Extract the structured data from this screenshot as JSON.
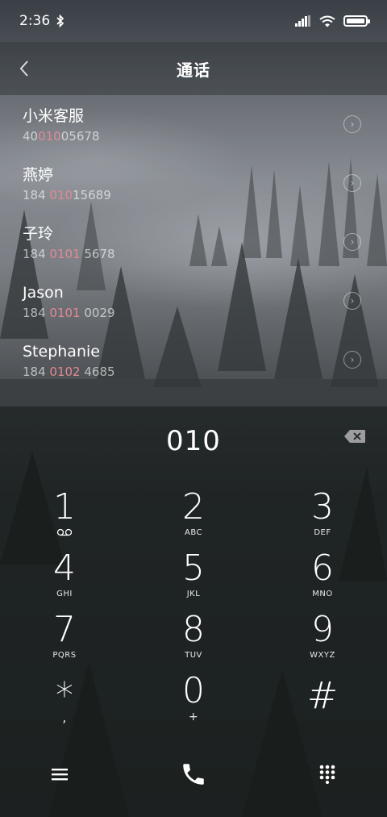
{
  "status_bar": {
    "time": "2:36",
    "icons": [
      "bluetooth-icon",
      "signal-icon",
      "wifi-icon",
      "battery-icon"
    ]
  },
  "header": {
    "title": "通话",
    "back_icon": "chevron-left-icon"
  },
  "results": [
    {
      "name": "小米客服",
      "number_pre": "40",
      "number_match": "010",
      "number_post": "05678"
    },
    {
      "name": "燕婷",
      "number_pre": "184 ",
      "number_match": "010",
      "number_post": "15689"
    },
    {
      "name": "子玲",
      "number_pre": "184 ",
      "number_match": "0101",
      "number_post": " 5678"
    },
    {
      "name": "Jason",
      "number_pre": "184 ",
      "number_match": "0101",
      "number_post": " 0029"
    },
    {
      "name": "Stephanie",
      "number_pre": "184 ",
      "number_match": "0102",
      "number_post": " 4685"
    }
  ],
  "dial": {
    "input": "010",
    "backspace_icon": "backspace-icon"
  },
  "keypad": [
    {
      "digit": "1",
      "letters": ""
    },
    {
      "digit": "2",
      "letters": "ABC"
    },
    {
      "digit": "3",
      "letters": "DEF"
    },
    {
      "digit": "4",
      "letters": "GHI"
    },
    {
      "digit": "5",
      "letters": "JKL"
    },
    {
      "digit": "6",
      "letters": "MNO"
    },
    {
      "digit": "7",
      "letters": "PQRS"
    },
    {
      "digit": "8",
      "letters": "TUV"
    },
    {
      "digit": "9",
      "letters": "WXYZ"
    },
    {
      "digit": "*",
      "letters": ","
    },
    {
      "digit": "0",
      "letters": "+"
    },
    {
      "digit": "#",
      "letters": ""
    }
  ],
  "bottom_bar": {
    "menu_icon": "menu-icon",
    "call_icon": "phone-icon",
    "dialpad_icon": "dialpad-icon"
  },
  "colors": {
    "match_highlight": "#e28a92"
  }
}
